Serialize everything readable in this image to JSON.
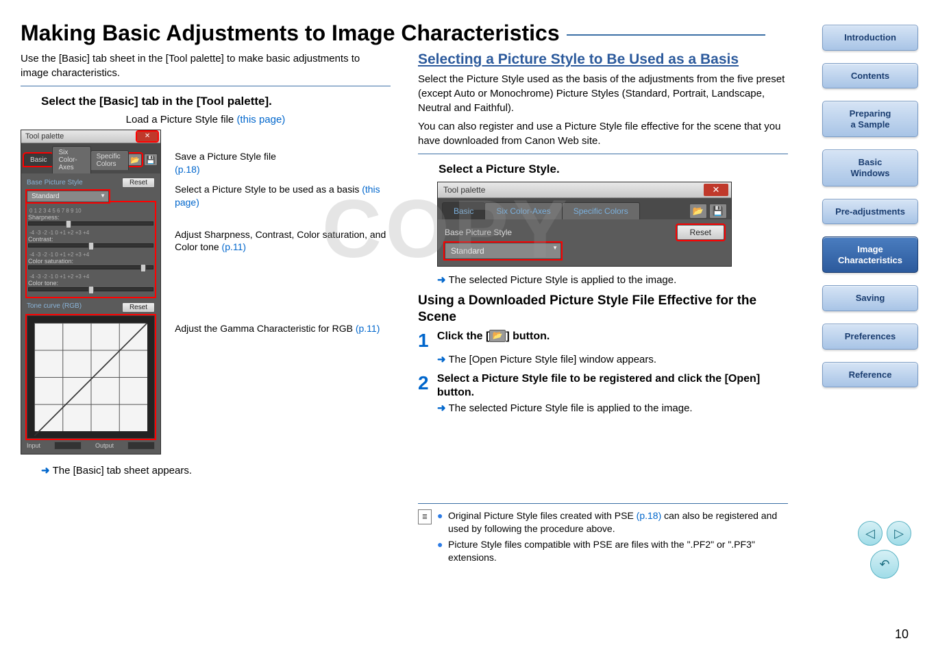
{
  "page_title": "Making Basic Adjustments to Image Characteristics",
  "intro": "Use the [Basic] tab sheet in the [Tool palette] to make basic adjustments to image characteristics.",
  "left": {
    "section_head": "Select the [Basic] tab in the [Tool palette].",
    "load_caption_pre": "Load a Picture Style file ",
    "load_caption_link": "(this page)",
    "callouts": {
      "save": "Save a Picture Style file",
      "save_link": "(p.18)",
      "select_basis_a": "Select a Picture Style to be used as a basis ",
      "select_basis_link": "(this page)",
      "adjust_a": "Adjust Sharpness, Contrast, Color saturation, and Color tone ",
      "adjust_link": "(p.11)",
      "gamma_a": "Adjust the Gamma Characteristic for RGB ",
      "gamma_link": "(p.11)"
    },
    "result": "The [Basic] tab sheet appears."
  },
  "right": {
    "h2": "Selecting a Picture Style to Be Used as a Basis",
    "p1": "Select the Picture Style used as the basis of the adjustments from the five preset (except Auto or Monochrome) Picture Styles (Standard, Portrait, Landscape, Neutral and Faithful).",
    "p2": "You can also register and use a Picture Style file effective for the scene that you have downloaded from Canon Web site.",
    "section_head": "Select a Picture Style.",
    "result1": "The selected Picture Style is applied to the image.",
    "h3": "Using a Downloaded Picture Style File Effective for the Scene",
    "step1_pre": "Click the [",
    "step1_post": "] button.",
    "step1_result": "The [Open Picture Style file] window appears.",
    "step2": "Select a Picture Style file to be registered and click the [Open] button.",
    "step2_result": "The selected Picture Style file is applied to the image.",
    "note1_a": "Original Picture Style files created with PSE ",
    "note1_link": "(p.18)",
    "note1_b": " can also be registered and used by following the procedure above.",
    "note2": "Picture Style files compatible with PSE are files with the \".PF2\" or \".PF3\" extensions."
  },
  "palette": {
    "title": "Tool palette",
    "close": "✕",
    "tab_basic": "Basic",
    "tab_six": "Six Color-Axes",
    "tab_specific": "Specific Colors",
    "base_label": "Base Picture Style",
    "reset": "Reset",
    "dropdown": "Standard",
    "slider_sharpness": "Sharpness:",
    "slider_contrast": "Contrast:",
    "slider_sat": "Color saturation:",
    "slider_tone": "Color tone:",
    "scale_0_10": "0  1  2  3  4  5  6  7  8  9  10",
    "scale_pm4": "-4  -3  -2  -1   0  +1  +2  +3  +4",
    "tone_curve_label": "Tone curve (RGB)",
    "input": "Input",
    "output": "Output"
  },
  "sidebar": {
    "items": [
      "Introduction",
      "Contents",
      "Preparing\na Sample",
      "Basic\nWindows",
      "Pre-adjustments",
      "Image\nCharacteristics",
      "Saving",
      "Preferences",
      "Reference"
    ]
  },
  "page_number": "10",
  "watermark": "COPY"
}
